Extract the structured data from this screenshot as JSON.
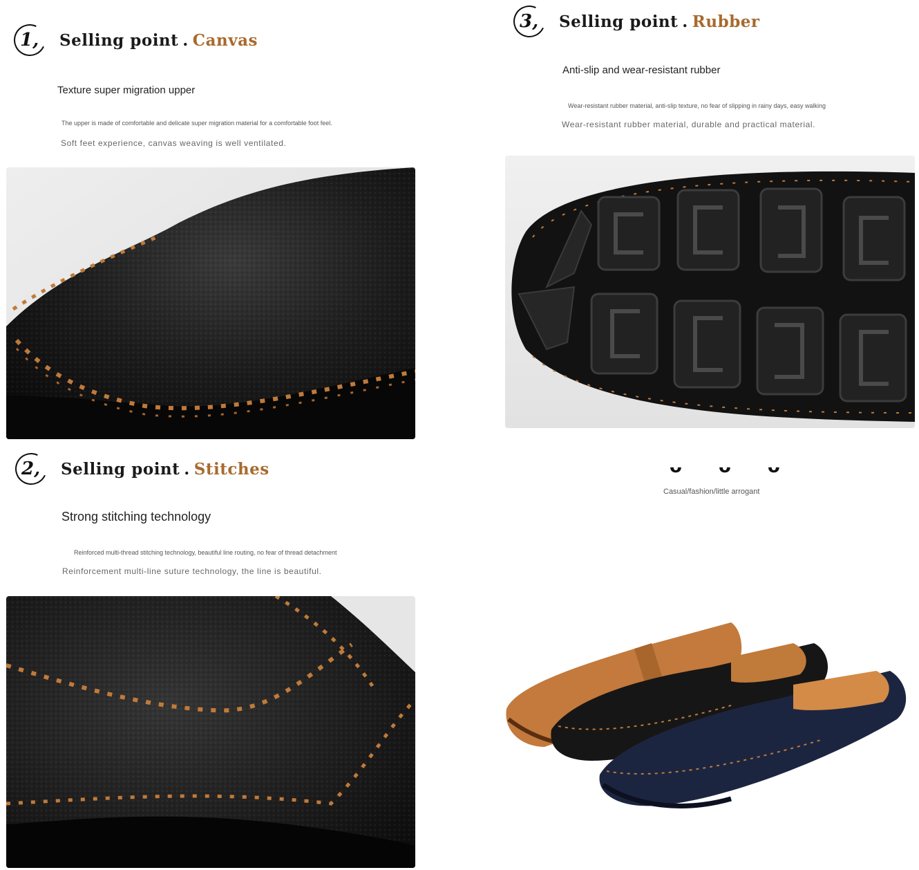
{
  "sections": [
    {
      "number": "1,",
      "label": "Selling point",
      "dot": ".",
      "feature": "Canvas",
      "subtitle": "Texture super migration upper",
      "desc_small": "The upper is made of comfortable and delicate super migration material for a comfortable foot feel.",
      "desc_line": "Soft feet experience, canvas weaving is well ventilated."
    },
    {
      "number": "2,",
      "label": "Selling point",
      "dot": ".",
      "feature": "Stitches",
      "subtitle": "Strong stitching technology",
      "desc_small": "Reinforced multi-thread stitching technology, beautiful line routing, no fear of thread detachment",
      "desc_line": "Reinforcement multi-line suture technology, the line is beautiful."
    },
    {
      "number": "3,",
      "label": "Selling point",
      "dot": ".",
      "feature": "Rubber",
      "subtitle": "Anti-slip and wear-resistant rubber",
      "desc_small": "Wear-resistant rubber material, anti-slip texture, no fear of slipping in rainy days, easy walking",
      "desc_line": "Wear-resistant rubber material, durable and practical material."
    }
  ],
  "brand_fragment": "ˊˊ ᴗ ᴗ ᴗ ᴗ ᴗ ˊˊ",
  "tagline": "Casual/fashion/little arrogant",
  "colors": {
    "accent": "#a86a2e",
    "leather_black": "#161616",
    "stitch": "#c07a3a",
    "tan": "#c37a3c",
    "navy": "#1c2540"
  }
}
